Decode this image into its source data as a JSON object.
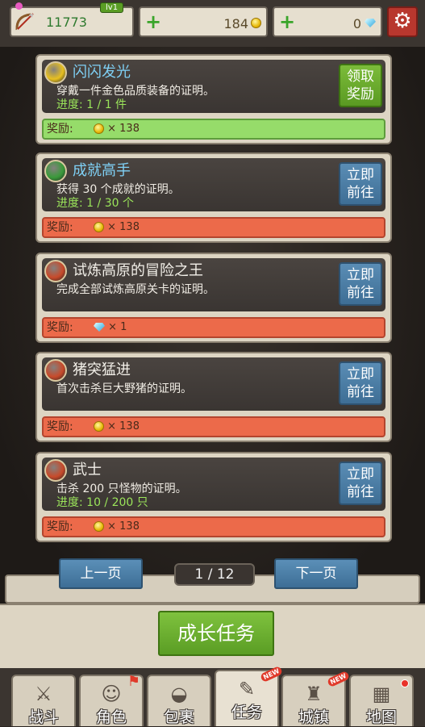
{
  "top": {
    "player": {
      "score": "11773",
      "level": "lv1",
      "icon": "bow-icon"
    },
    "gold": {
      "value": "184",
      "icon": "coin-icon"
    },
    "gems": {
      "value": "0",
      "icon": "gem-icon"
    },
    "settings_icon": "gear-icon"
  },
  "quests": [
    {
      "title": "闪闪发光",
      "title_color": "#7fd0f5",
      "desc": "穿戴一件金色品质装备的证明。",
      "progress": "进度: 1 / 1 件",
      "button": "领取奖励",
      "button_style": "green",
      "reward_label": "奖励:",
      "reward_value": "× 138",
      "reward_type": "coin",
      "reward_style": "green",
      "icon": "helmet-icon",
      "icon_color": "#e8c020"
    },
    {
      "title": "成就高手",
      "title_color": "#7fd0f5",
      "desc": "获得 30 个成就的证明。",
      "progress": "进度: 1 / 30 个",
      "button": "立即前往",
      "button_style": "blue",
      "reward_label": "奖励:",
      "reward_value": "× 138",
      "reward_type": "coin",
      "reward_style": "red",
      "icon": "achievement-icon",
      "icon_color": "#3a9a3a"
    },
    {
      "title": "试炼高原的冒险之王",
      "title_color": "#f2efe8",
      "desc": "完成全部试炼高原关卡的证明。",
      "progress": "",
      "button": "立即前往",
      "button_style": "blue",
      "reward_label": "奖励:",
      "reward_value": "× 1",
      "reward_type": "gem",
      "reward_style": "red",
      "icon": "sword-icon",
      "icon_color": "#c84a2a"
    },
    {
      "title": "猪突猛进",
      "title_color": "#f2efe8",
      "desc": "首次击杀巨大野猪的证明。",
      "progress": "",
      "button": "立即前往",
      "button_style": "blue",
      "reward_label": "奖励:",
      "reward_value": "× 138",
      "reward_type": "coin",
      "reward_style": "red",
      "icon": "sword-icon",
      "icon_color": "#c84a2a"
    },
    {
      "title": "武士",
      "title_color": "#f2efe8",
      "desc": "击杀 200 只怪物的证明。",
      "progress": "进度: 10 / 200 只",
      "button": "立即前往",
      "button_style": "blue",
      "reward_label": "奖励:",
      "reward_value": "× 138",
      "reward_type": "coin",
      "reward_style": "red",
      "icon": "sword-icon",
      "icon_color": "#c84a2a"
    }
  ],
  "pager": {
    "prev": "上一页",
    "next": "下一页",
    "current": "1 / 12"
  },
  "section_title": "成长任务",
  "nav": [
    {
      "label": "战斗",
      "icon": "crossed-swords-icon",
      "glyph": "⚔",
      "active": false,
      "badge": ""
    },
    {
      "label": "角色",
      "icon": "character-icon",
      "glyph": "☺",
      "active": false,
      "badge": "flag"
    },
    {
      "label": "包裹",
      "icon": "bag-icon",
      "glyph": "◒",
      "active": false,
      "badge": ""
    },
    {
      "label": "任务",
      "icon": "quest-icon",
      "glyph": "✎",
      "active": true,
      "badge": "NEW"
    },
    {
      "label": "城镇",
      "icon": "castle-icon",
      "glyph": "♜",
      "active": false,
      "badge": "NEW"
    },
    {
      "label": "地图",
      "icon": "map-icon",
      "glyph": "▦",
      "active": false,
      "badge": "dot"
    }
  ],
  "colors": {
    "accent_green": "#5a9d24",
    "accent_blue": "#3d6e96",
    "reward_red": "#ec6a4a",
    "reward_green": "#96dc6a"
  }
}
